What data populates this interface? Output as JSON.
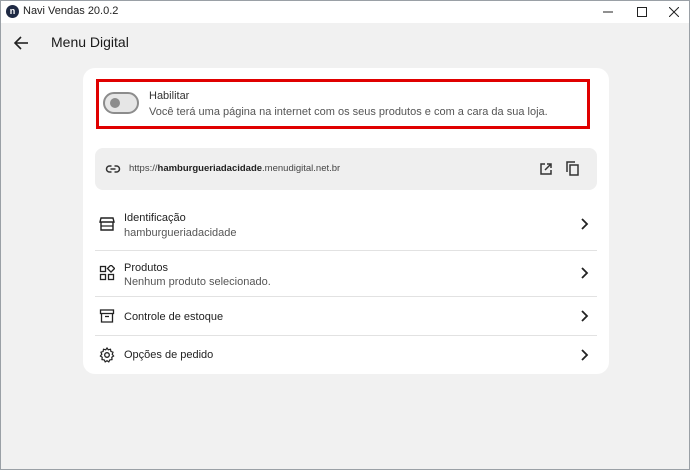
{
  "window": {
    "title": "Navi Vendas 20.0.2",
    "logo_letter": "n"
  },
  "header": {
    "title": "Menu Digital"
  },
  "enable": {
    "label": "Habilitar",
    "description": "Você terá uma página na internet com os seus produtos e com a cara da sua loja.",
    "enabled": false
  },
  "url": {
    "prefix": "https://",
    "subdomain": "hamburgueriadacidade",
    "domain": ".menudigital.net.br"
  },
  "menu": {
    "items": [
      {
        "label": "Identificação",
        "sublabel": "hamburgueriadacidade",
        "icon": "store-icon"
      },
      {
        "label": "Produtos",
        "sublabel": "Nenhum produto selecionado.",
        "icon": "widgets-icon"
      },
      {
        "label": "Controle de estoque",
        "sublabel": "",
        "icon": "archive-icon"
      },
      {
        "label": "Opções de pedido",
        "sublabel": "",
        "icon": "gear-icon"
      }
    ]
  },
  "colors": {
    "highlight": "#e00000",
    "background": "#f1f1f1",
    "card": "#ffffff"
  }
}
